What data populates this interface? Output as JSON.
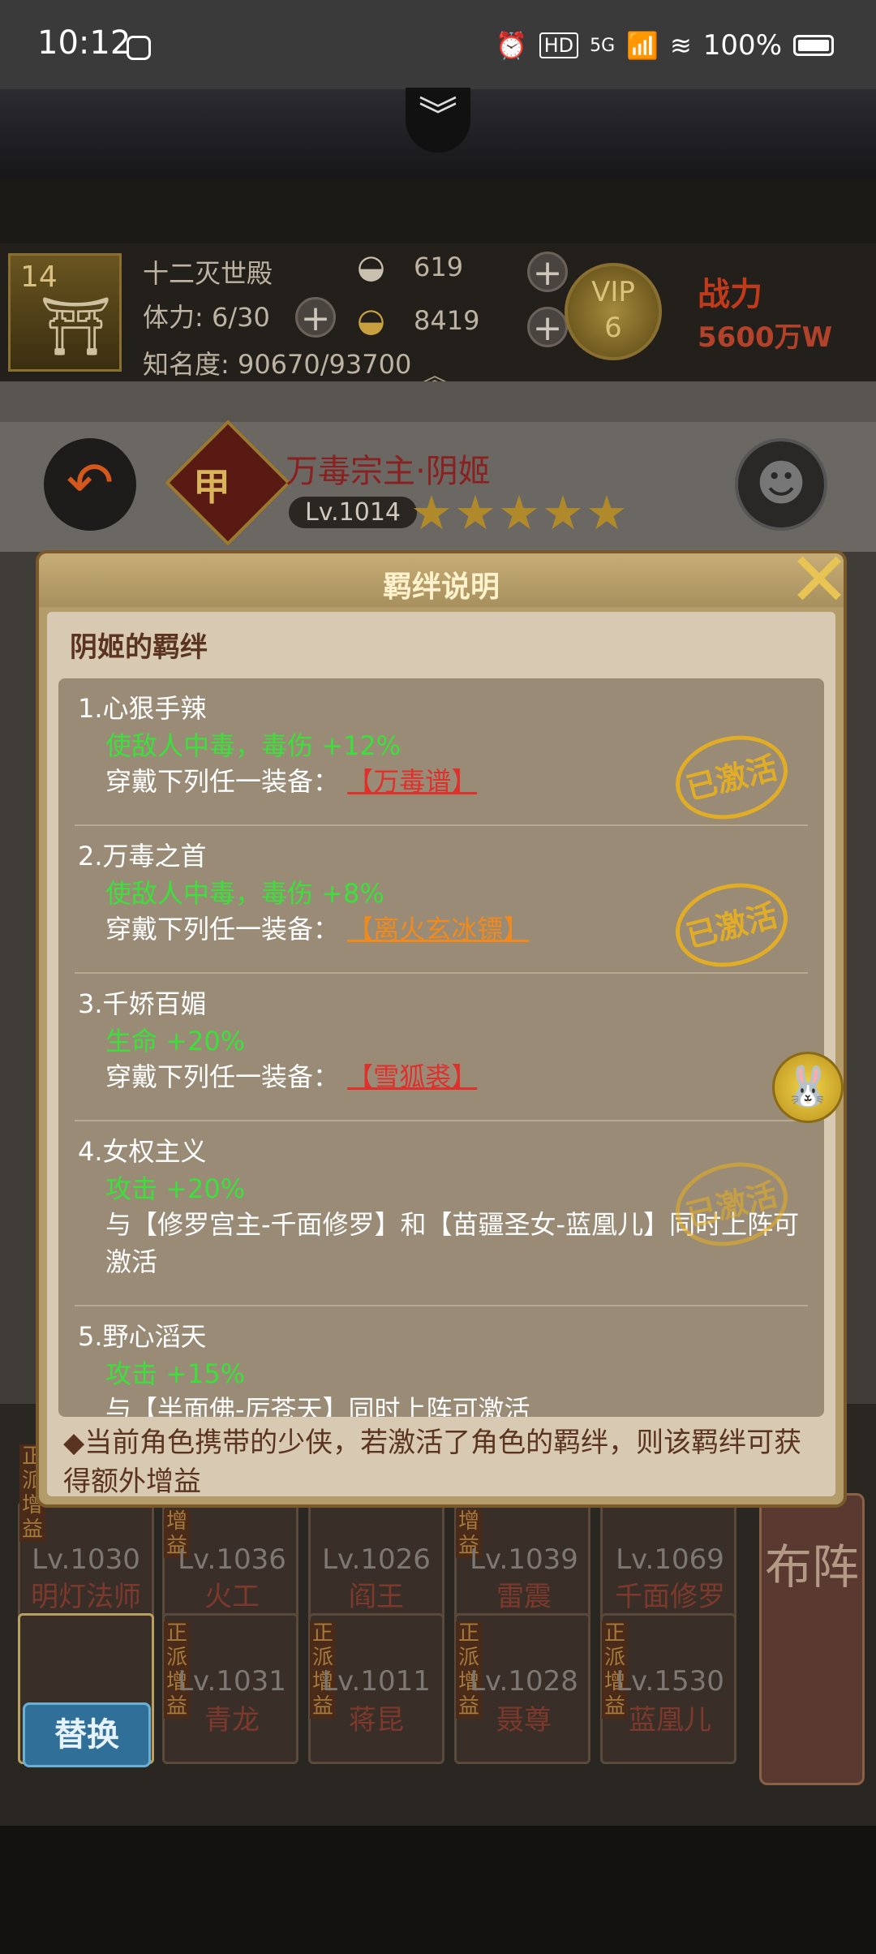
{
  "status_bar": {
    "time": "10:12",
    "battery": "100%",
    "network": "5G"
  },
  "player": {
    "level": "14",
    "realm": "十二灭世殿",
    "stamina": "体力: 6/30",
    "fame": "知名度: 90670/93700",
    "silver": "619",
    "gold": "8419",
    "vip_label": "VIP",
    "vip_level": "6",
    "power_label": "战力",
    "power_value": "5600万W"
  },
  "hero": {
    "name": "万毒宗主·阴姬",
    "badge": "甲",
    "level": "Lv.1014",
    "stars": "★★★★★"
  },
  "modal": {
    "title": "羁绊说明",
    "heading": "阴姬的羁绊",
    "bonds": [
      {
        "title": "1.心狠手辣",
        "effect": "使敌人中毒，毒伤 +12%",
        "req_prefix": "穿戴下列任一装备：",
        "equip": "【万毒谱】",
        "status": "已激活"
      },
      {
        "title": "2.万毒之首",
        "effect": "使敌人中毒，毒伤 +8%",
        "req_prefix": "穿戴下列任一装备：",
        "equip": "【离火玄冰镖】",
        "status": "已激活"
      },
      {
        "title": "3.千娇百媚",
        "effect": "生命 +20%",
        "req_prefix": "穿戴下列任一装备：",
        "equip": "【雪狐裘】"
      },
      {
        "title": "4.女权主义",
        "effect": "攻击 +20%",
        "req": "与【修罗宫主-千面修罗】和【苗疆圣女-蓝凰儿】同时上阵可激活",
        "status": "已激活"
      },
      {
        "title": "5.野心滔天",
        "effect": "攻击 +15%",
        "req": "与【半面佛-厉苍天】同时上阵可激活"
      }
    ],
    "note": "◆当前角色携带的少侠，若激活了角色的羁绊，则该羁绊可获得额外增益"
  },
  "team": {
    "row1": [
      {
        "level": "Lv.1030",
        "name": "明灯法师",
        "tag": "正派增益"
      },
      {
        "level": "Lv.1036",
        "name": "火工",
        "tag": "增益"
      },
      {
        "level": "Lv.1026",
        "name": "阎王"
      },
      {
        "level": "Lv.1039",
        "name": "雷震",
        "tag": "增益"
      },
      {
        "level": "Lv.1069",
        "name": "千面修罗"
      }
    ],
    "row2": [
      {
        "level": "Lv.1031",
        "name": "青龙"
      },
      {
        "level": "Lv.1011",
        "name": "蒋昆",
        "tag": "正派增益"
      },
      {
        "level": "Lv.1028",
        "name": "聂尊",
        "tag": "正派增益"
      },
      {
        "level": "Lv.1530",
        "name": "蓝凰儿",
        "tag": "正派增益"
      }
    ],
    "tag_row2_first": "正派增益",
    "swap_label": "替换",
    "formation_label": "布阵"
  }
}
